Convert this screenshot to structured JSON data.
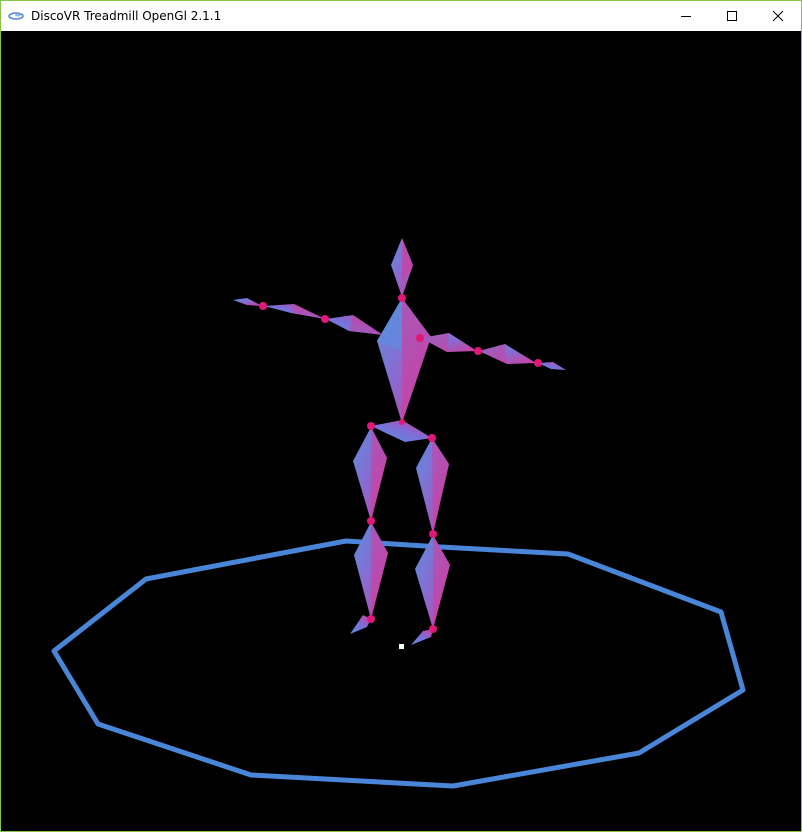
{
  "window": {
    "title": "DiscoVR Treadmill OpenGl 2.1.1",
    "border_color": "#8bc34a"
  },
  "titlebar": {
    "app_icon": "discovr-app-icon",
    "controls": [
      {
        "name": "minimize-icon",
        "glyph": "—"
      },
      {
        "name": "maximize-icon",
        "glyph": "□"
      },
      {
        "name": "close-icon",
        "glyph": "✕"
      }
    ]
  },
  "scene": {
    "background": "#000000",
    "boundary_color": "#4a86d8",
    "bone_color_a": "#5a8fe0",
    "bone_color_b": "#d63a9a",
    "joint_color": "#e0187a",
    "center_marker_color": "#ffffff"
  }
}
